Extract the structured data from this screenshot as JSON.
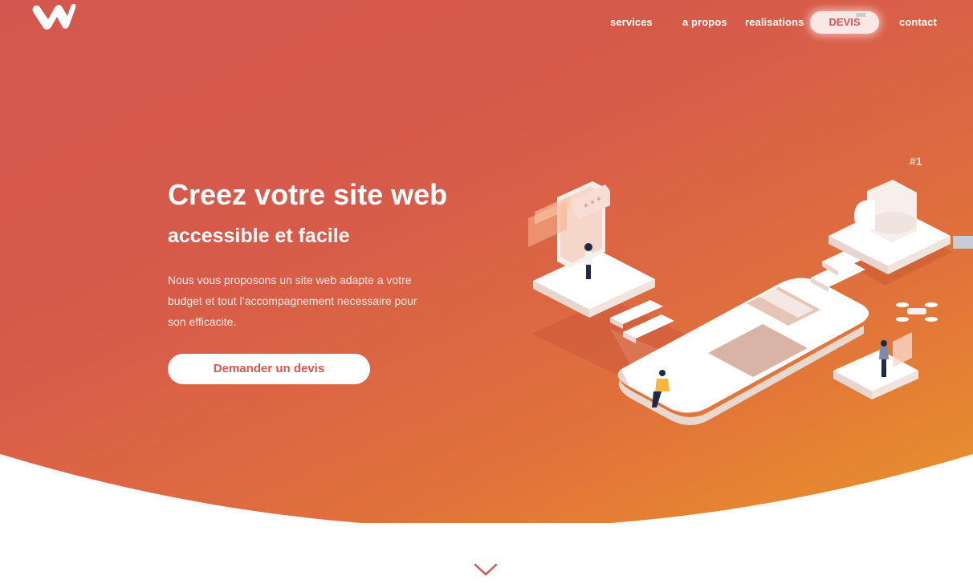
{
  "brand": {
    "logo": "w-logo-icon"
  },
  "nav": {
    "items": [
      "services",
      "a propos",
      "realisations",
      "contact"
    ],
    "devis_label": "DEVIS"
  },
  "hero": {
    "title": "Creez votre site web",
    "subtitle": "accessible et facile",
    "text": "Nous vous proposons un site web adapte a votre budget et tout l’accompagnement necessaire pour son efficacite.",
    "cta_label": "Demander un devis",
    "badge": "#1"
  },
  "icons": {
    "scroll": "chevron-down-icon"
  },
  "colors": {
    "accent": "#d4574f",
    "gradient_start": "#d4574f",
    "gradient_end": "#e9932a",
    "background": "#ffffff"
  }
}
